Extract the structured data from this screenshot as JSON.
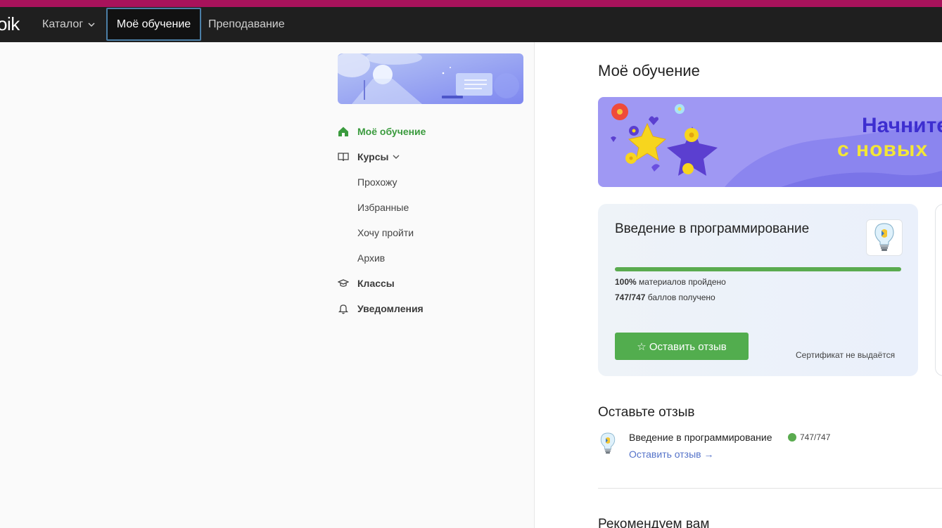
{
  "brand": {
    "logo_text": "oik"
  },
  "nav": {
    "catalog_label": "Каталог",
    "my_learning_label": "Моё обучение",
    "teaching_label": "Преподавание"
  },
  "sidebar": {
    "items": [
      {
        "label": "Моё обучение",
        "icon": "home-icon",
        "active": true
      },
      {
        "label": "Курсы",
        "icon": "book-icon",
        "expandable": true
      },
      {
        "label": "Прохожу"
      },
      {
        "label": "Избранные"
      },
      {
        "label": "Хочу пройти"
      },
      {
        "label": "Архив"
      },
      {
        "label": "Классы",
        "icon": "graduation-cap-icon"
      },
      {
        "label": "Уведомления",
        "icon": "bell-icon"
      }
    ]
  },
  "main": {
    "title": "Моё обучение",
    "promo": {
      "line1": "Начните",
      "line2": "с новых"
    },
    "course_card": {
      "title": "Введение в программирование",
      "progress_percent": 100,
      "progress_bold": "100%",
      "progress_text": "материалов пройдено",
      "score_bold": "747/747",
      "score_text": "баллов получено",
      "review_button": "☆ Оставить отзыв",
      "certificate": "Сертификат не выдаётся"
    },
    "review_section": {
      "title": "Оставьте отзыв",
      "course": "Введение в программирование",
      "score": "747/747",
      "link": "Оставить отзыв →"
    },
    "recommend_title": "Рекомендуем вам"
  },
  "colors": {
    "accent_green": "#52ad4e",
    "link_blue": "#5573c9",
    "top_strip": "#a8125b",
    "navbar": "#1f1f1f"
  }
}
